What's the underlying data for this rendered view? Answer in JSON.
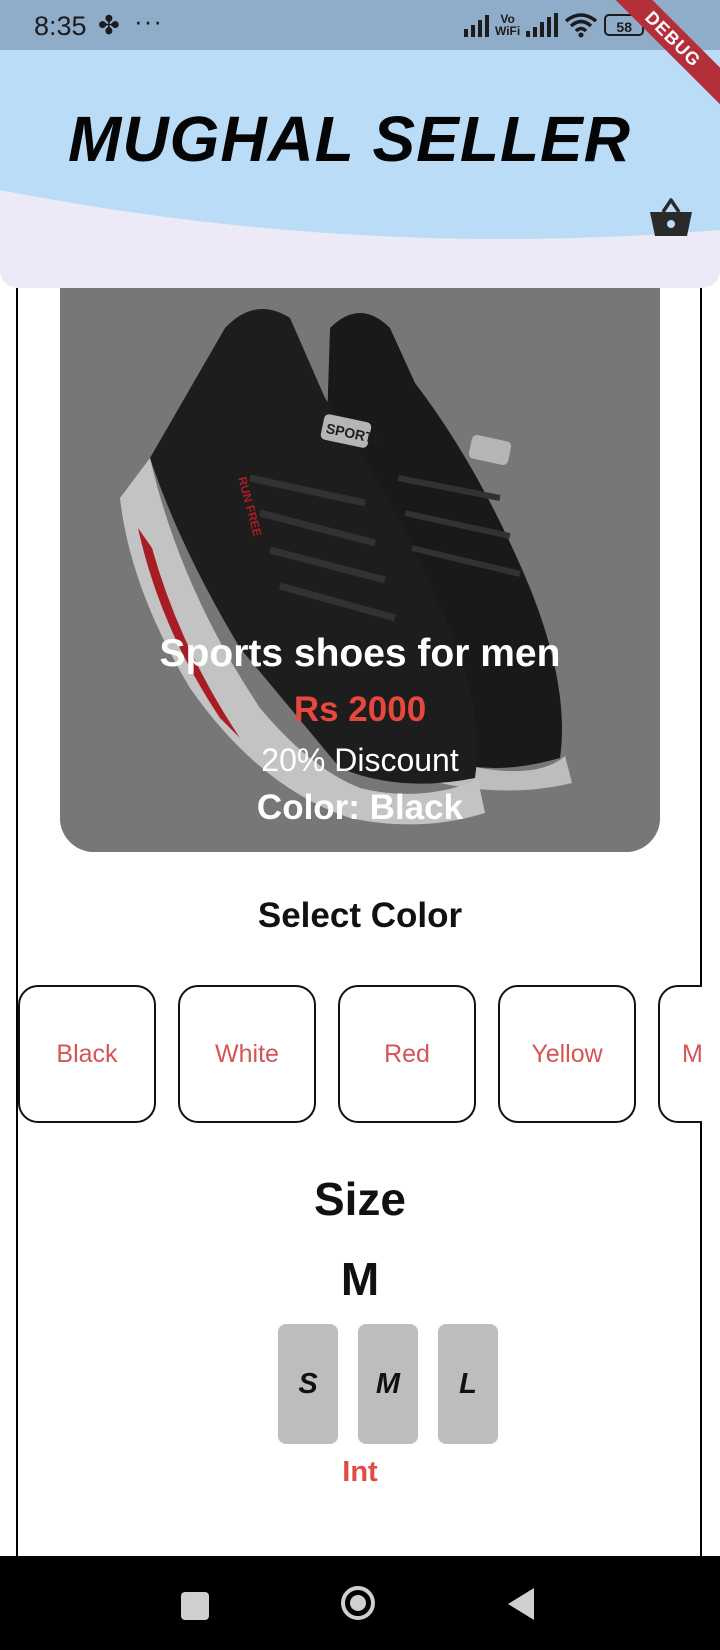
{
  "status_bar": {
    "time": "8:35",
    "fan_icon": "pinwheel-icon",
    "more_dots": "···",
    "vowifi_top": "Vo",
    "vowifi_bottom": "WiFi",
    "battery": "58"
  },
  "debug_banner": "DEBUG",
  "header": {
    "title": "MUGHAL SELLER",
    "cart_icon": "basket-icon",
    "colors": {
      "wave": "#bbdcf7",
      "background": "#ebeaf6"
    }
  },
  "product": {
    "name": "Sports shoes for men",
    "price": "Rs 2000",
    "discount": "20% Discount",
    "color_line": "Color: Black",
    "image_brand": "SPORTS",
    "image_side_text": "RUN FREE"
  },
  "color_section": {
    "heading": "Select Color",
    "options": [
      "Black",
      "White",
      "Red",
      "Yellow",
      "M"
    ]
  },
  "size_section": {
    "heading": "Size",
    "selected": "M",
    "options": [
      "S",
      "M",
      "L"
    ],
    "unit_label": "Int"
  },
  "nav_bar": {
    "recents_icon": "recents-square-icon",
    "home_icon": "home-circle-icon",
    "back_icon": "back-triangle-icon"
  },
  "colors": {
    "price": "#e8473c",
    "chip_text": "#d65454",
    "size_button": "#bdbdbd",
    "card_overlay": "#888888"
  }
}
